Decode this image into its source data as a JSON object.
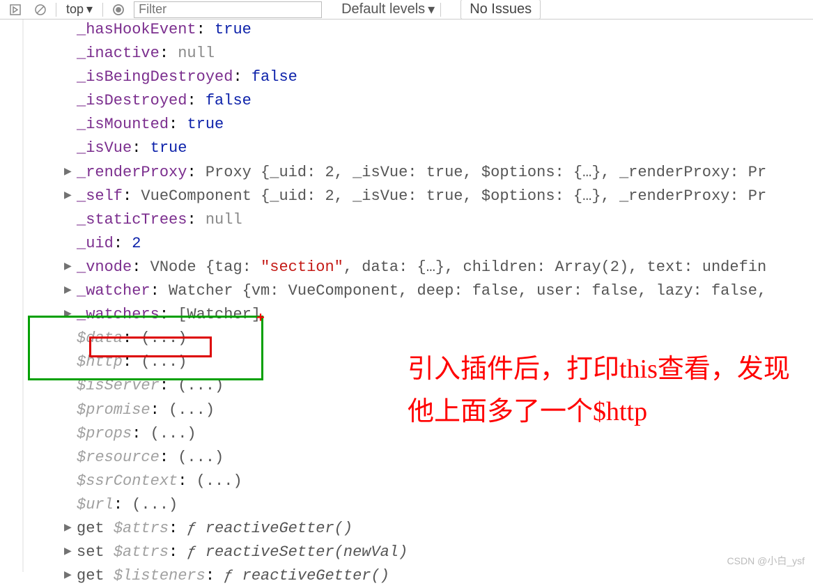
{
  "toolbar": {
    "execution_context": "top",
    "filter_placeholder": "Filter",
    "levels_label": "Default levels",
    "issues_label": "No Issues"
  },
  "annotation": "引入插件后，打印this查看，发现他上面多了一个$http",
  "watermark": "CSDN @小白_ysf",
  "props": {
    "_hasHookEvent": {
      "key": "_hasHookEvent",
      "value": "true",
      "cls": "v-true"
    },
    "_inactive": {
      "key": "_inactive",
      "value": "null",
      "cls": "v-null"
    },
    "_isBeingDestroyed": {
      "key": "_isBeingDestroyed",
      "value": "false",
      "cls": "v-false"
    },
    "_isDestroyed": {
      "key": "_isDestroyed",
      "value": "false",
      "cls": "v-false"
    },
    "_isMounted": {
      "key": "_isMounted",
      "value": "true",
      "cls": "v-true"
    },
    "_isVue": {
      "key": "_isVue",
      "value": "true",
      "cls": "v-true"
    },
    "_renderProxy": {
      "key": "_renderProxy",
      "type": "Proxy",
      "inner": "{_uid: 2, _isVue: true, $options: {…}, _renderProxy: Pr"
    },
    "_self": {
      "key": "_self",
      "type": "VueComponent",
      "inner": "{_uid: 2, _isVue: true, $options: {…}, _renderProxy: Pr"
    },
    "_staticTrees": {
      "key": "_staticTrees",
      "value": "null",
      "cls": "v-null"
    },
    "_uid": {
      "key": "_uid",
      "value": "2",
      "cls": "v-num"
    },
    "_vnode": {
      "key": "_vnode",
      "type": "VNode",
      "pre": "{tag: ",
      "str": "\"section\"",
      "post": ", data: {…}, children: Array(2), text: undefin"
    },
    "_watcher": {
      "key": "_watcher",
      "type": "Watcher",
      "inner": "{vm: VueComponent, deep: false, user: false, lazy: false,"
    },
    "_watchers": {
      "key": "_watchers",
      "value": "[Watcher]"
    },
    "data": {
      "key": "$data",
      "value": "(...)"
    },
    "http": {
      "key": "$http",
      "value": "(...)"
    },
    "isServer": {
      "key": "$isServer",
      "value": "(...)"
    },
    "promise": {
      "key": "$promise",
      "value": "(...)"
    },
    "props2": {
      "key": "$props",
      "value": "(...)"
    },
    "resource": {
      "key": "$resource",
      "value": "(...)"
    },
    "ssrContext": {
      "key": "$ssrContext",
      "value": "(...)"
    },
    "url": {
      "key": "$url",
      "value": "(...)"
    },
    "get_attrs": {
      "pre": "get ",
      "key": "$attrs",
      "fn": "reactiveGetter()"
    },
    "set_attrs": {
      "pre": "set ",
      "key": "$attrs",
      "fn": "reactiveSetter(newVal)"
    },
    "get_listeners": {
      "pre": "get ",
      "key": "$listeners",
      "fn": "reactiveGetter()"
    }
  }
}
